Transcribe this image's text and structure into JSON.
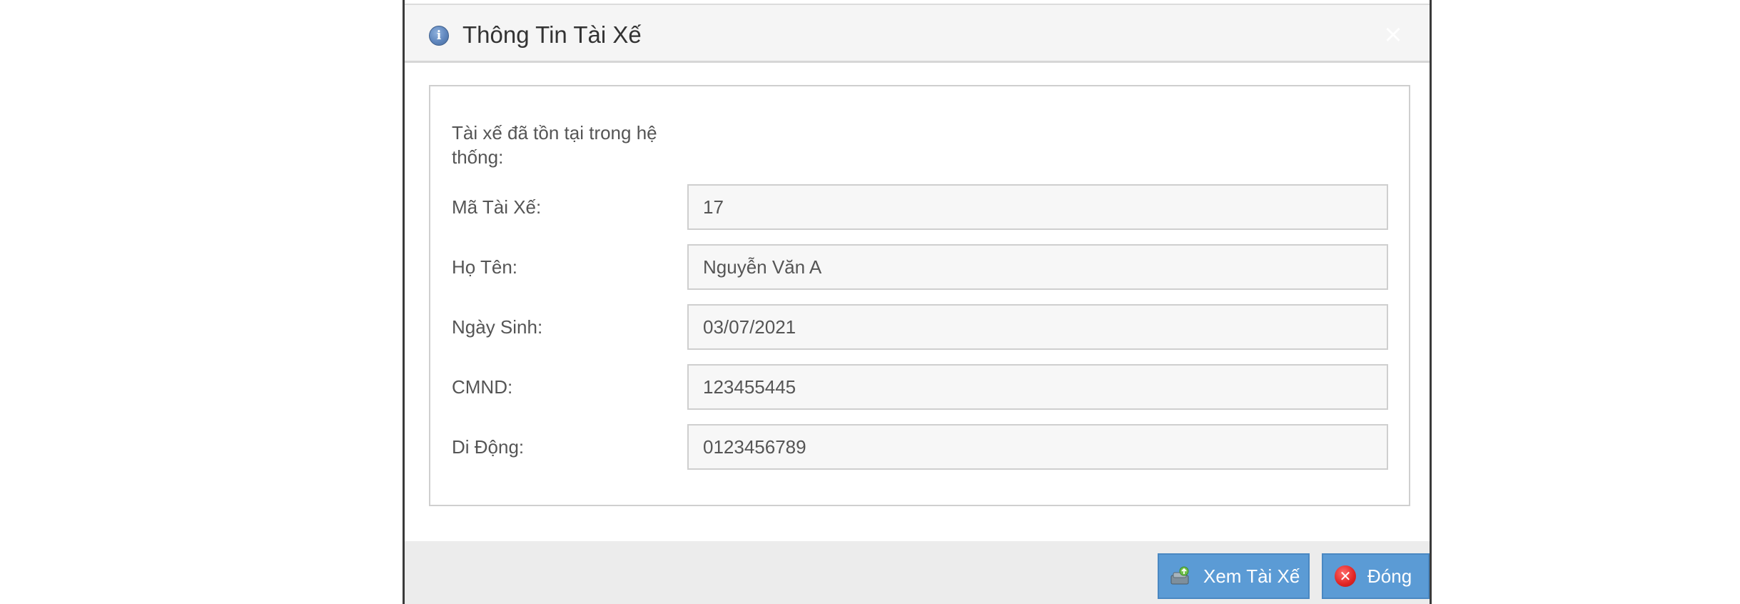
{
  "dialog": {
    "title": "Thông Tin Tài Xế",
    "close_symbol": "×"
  },
  "body": {
    "intro_text": "Tài xế đã tồn tại trong hệ thống:",
    "fields": [
      {
        "label": "Mã Tài Xế:",
        "value": "17"
      },
      {
        "label": "Họ Tên:",
        "value": "Nguyễn Văn A"
      },
      {
        "label": "Ngày Sinh:",
        "value": "03/07/2021"
      },
      {
        "label": "CMND:",
        "value": "123455445"
      },
      {
        "label": "Di Động:",
        "value": "0123456789"
      }
    ]
  },
  "footer": {
    "view_label": "Xem Tài Xế",
    "close_label": "Đóng"
  },
  "icons": {
    "header": "info-icon",
    "view_button": "view-driver-icon",
    "close_button": "close-circle-icon"
  },
  "colors": {
    "button": "#5b9bd5",
    "header_bg": "#f5f5f5",
    "footer_bg": "#ececec",
    "close_red": "#e02424"
  }
}
